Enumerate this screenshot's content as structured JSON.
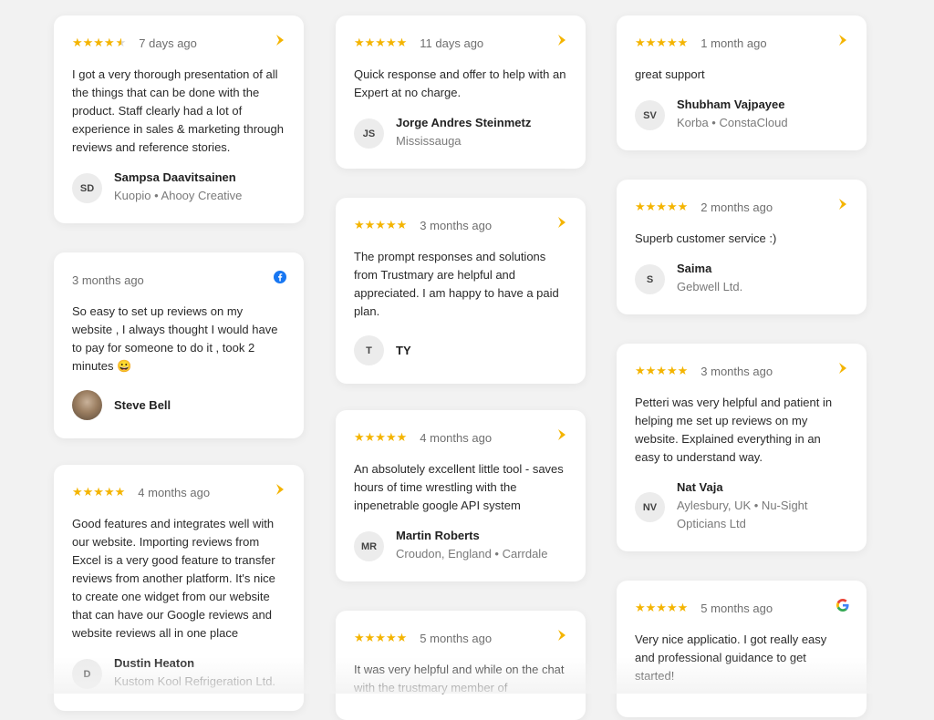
{
  "brand_colors": {
    "star": "#f4b400",
    "trustmary_icon": "#f4b400",
    "facebook": "#1877f2"
  },
  "reviews": [
    {
      "stars": "★★★★",
      "half_star": "★",
      "time": "7 days ago",
      "source": "trustmary-icon",
      "text": "I got a very thorough presentation of all the things that can be done with the product. Staff clearly had a lot of experience in sales & marketing through reviews and reference stories.",
      "initials": "SD",
      "name": "Sampsa Daavitsainen",
      "meta": "Kuopio • Ahooy Creative"
    },
    {
      "time": "3 months ago",
      "source": "facebook-icon",
      "text": "So easy to set up reviews on my website , I always thought I would have to pay for someone to do it , took 2 minutes 😀",
      "initials": "",
      "name": "Steve Bell",
      "meta": ""
    },
    {
      "stars": "★★★★★",
      "time": "4 months ago",
      "source": "trustmary-icon",
      "text": "Good features and integrates well with our website. Importing reviews from Excel is a very good feature to transfer reviews from another platform. It's nice to create one widget from our website that can have our Google reviews and website reviews all in one place",
      "initials": "D",
      "name": "Dustin Heaton",
      "meta": "Kustom Kool Refrigeration Ltd."
    },
    {
      "stars": "★★★★★",
      "time": "11 days ago",
      "source": "trustmary-icon",
      "text": "Quick response and offer to help with an Expert at no charge.",
      "initials": "JS",
      "name": "Jorge Andres Steinmetz",
      "meta": "Mississauga"
    },
    {
      "stars": "★★★★★",
      "time": "3 months ago",
      "source": "trustmary-icon",
      "text": "The prompt responses and solutions from Trustmary are helpful and appreciated. I am happy to have a paid plan.",
      "initials": "T",
      "name": "TY",
      "meta": ""
    },
    {
      "stars": "★★★★★",
      "time": "4 months ago",
      "source": "trustmary-icon",
      "text": "An absolutely excellent little tool - saves hours of time wrestling with the inpenetrable google API system",
      "initials": "MR",
      "name": "Martin Roberts",
      "meta": "Croudon, England • Carrdale"
    },
    {
      "stars": "★★★★★",
      "time": "5 months ago",
      "source": "trustmary-icon",
      "text": "It was very helpful and while on the chat with the trustmary member of",
      "initials": "",
      "name": "",
      "meta": ""
    },
    {
      "stars": "★★★★★",
      "time": "1 month ago",
      "source": "trustmary-icon",
      "text": "great support",
      "initials": "SV",
      "name": "Shubham Vajpayee",
      "meta": "Korba • ConstaCloud"
    },
    {
      "stars": "★★★★★",
      "time": "2 months ago",
      "source": "trustmary-icon",
      "text": "Superb customer service :)",
      "initials": "S",
      "name": "Saima",
      "meta": "Gebwell Ltd."
    },
    {
      "stars": "★★★★★",
      "time": "3 months ago",
      "source": "trustmary-icon",
      "text": "Petteri was very helpful and patient in helping me set up reviews on my website. Explained everything in an easy to understand way.",
      "initials": "NV",
      "name": "Nat Vaja",
      "meta": "Aylesbury, UK • Nu-Sight Opticians Ltd"
    },
    {
      "stars": "★★★★★",
      "time": "5 months ago",
      "source": "google-icon",
      "text": "Very nice applicatio. I got really easy and professional guidance to get started!",
      "initials": "",
      "name": "",
      "meta": ""
    }
  ]
}
